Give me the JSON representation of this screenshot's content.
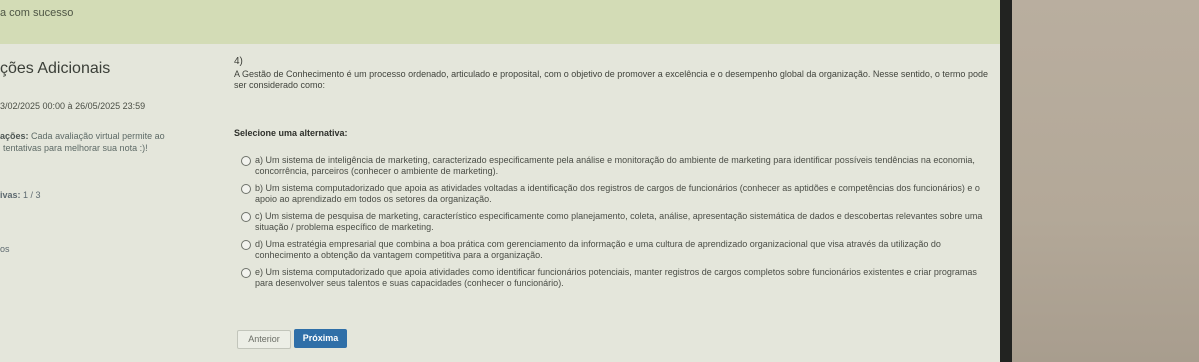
{
  "banner": {
    "text": "a com sucesso"
  },
  "sidebar": {
    "title": "ções Adicionais",
    "dates": "3/02/2025 00:00 à 26/05/2025 23:59",
    "note_label": "ações:",
    "note_line1": "Cada avaliação virtual permite ao",
    "note_line2": "tentativas para melhorar sua nota :)!",
    "attempts_label": "ivas:",
    "attempts_value": "1 / 3",
    "fragment": "os"
  },
  "question": {
    "number": "4)",
    "stem": "A Gestão de Conhecimento é um processo ordenado, articulado e proposital, com o objetivo de promover a excelência e o desempenho global da organização. Nesse sentido, o termo pode ser considerado como:",
    "prompt": "Selecione uma alternativa:",
    "options": [
      {
        "text": "a) Um sistema de inteligência de marketing, caracterizado especificamente pela análise e monitoração do ambiente de marketing para identificar possíveis tendências na economia, concorrência, parceiros (conhecer o ambiente de marketing)."
      },
      {
        "text": "b) Um sistema computadorizado que apoia as atividades voltadas a identificação dos registros de cargos de funcionários (conhecer as aptidões e competências dos funcionários) e o apoio ao aprendizado em todos os setores da organização."
      },
      {
        "text": "c) Um sistema de pesquisa de marketing, característico especificamente como planejamento, coleta, análise, apresentação sistemática de dados e descobertas relevantes sobre uma situação / problema específico de marketing."
      },
      {
        "text": "d) Uma estratégia empresarial que combina a boa prática com gerenciamento da informação e uma cultura de aprendizado organizacional que visa através da utilização do conhecimento a obtenção da vantagem competitiva para a organização."
      },
      {
        "text": "e) Um sistema computadorizado que apoia atividades como identificar funcionários potenciais, manter registros de cargos completos sobre funcionários existentes e criar programas para desenvolver seus talentos e suas capacidades (conhecer o funcionário)."
      }
    ]
  },
  "nav": {
    "prev_label": "Anterior",
    "next_label": "Próxima"
  },
  "colors": {
    "banner": "#d3dcb6",
    "next_button": "#2f6fa8",
    "page": "#e4e6db"
  }
}
